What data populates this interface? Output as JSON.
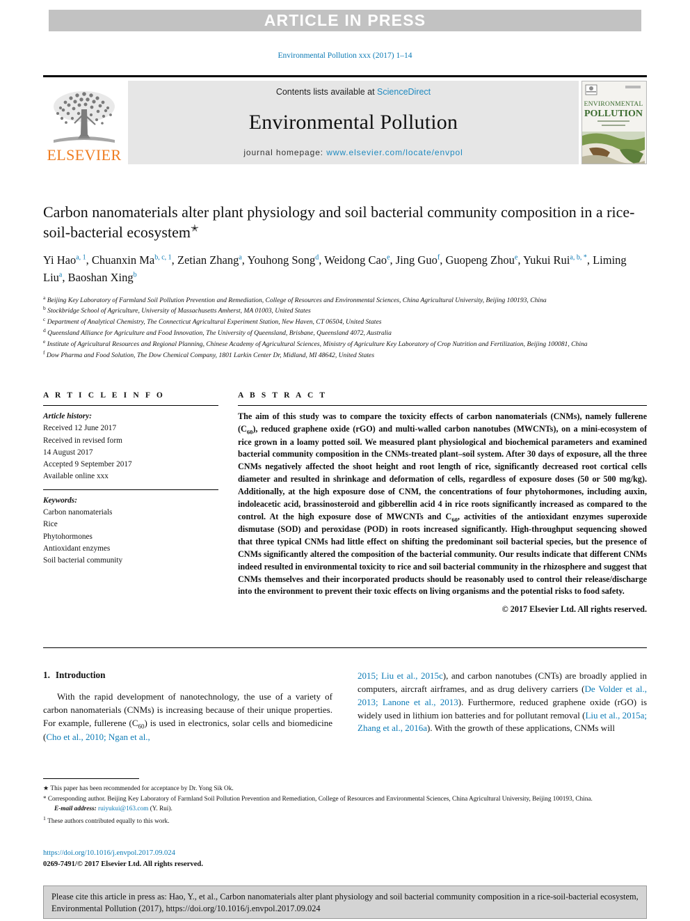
{
  "banner": {
    "label": "ARTICLE IN PRESS"
  },
  "running_head": "Environmental Pollution xxx (2017) 1–14",
  "masthead": {
    "publisher_name": "ELSEVIER",
    "contents_prefix": "Contents lists available at ",
    "contents_link": "ScienceDirect",
    "journal_name": "Environmental Pollution",
    "homepage_prefix": "journal homepage: ",
    "homepage_url": "www.elsevier.com/locate/envpol",
    "cover_title_line1": "ENVIRONMENTAL",
    "cover_title_line2": "POLLUTION"
  },
  "article": {
    "title": "Carbon nanomaterials alter plant physiology and soil bacterial community composition in a rice-soil-bacterial ecosystem",
    "title_marker": "✭",
    "authors": [
      {
        "name": "Yi Hao",
        "sup": "a, 1",
        "sep": ", "
      },
      {
        "name": "Chuanxin Ma",
        "sup": "b, c, 1",
        "sep": ", "
      },
      {
        "name": "Zetian Zhang",
        "sup": "a",
        "sep": ", "
      },
      {
        "name": "Youhong Song",
        "sup": "d",
        "sep": ", "
      },
      {
        "name": "Weidong Cao",
        "sup": "e",
        "sep": ", "
      },
      {
        "name": "Jing Guo",
        "sup": "f",
        "sep": ", "
      },
      {
        "name": "Guopeng Zhou",
        "sup": "e",
        "sep": ", "
      },
      {
        "name": "Yukui Rui",
        "sup": "a, b, *",
        "sep": ", "
      },
      {
        "name": "Liming Liu",
        "sup": "a",
        "sep": ", "
      },
      {
        "name": "Baoshan Xing",
        "sup": "b",
        "sep": ""
      }
    ],
    "affiliations": [
      {
        "mark": "a",
        "text": "Beijing Key Laboratory of Farmland Soil Pollution Prevention and Remediation, College of Resources and Environmental Sciences, China Agricultural University, Beijing 100193, China"
      },
      {
        "mark": "b",
        "text": "Stockbridge School of Agriculture, University of Massachusetts Amherst, MA 01003, United States"
      },
      {
        "mark": "c",
        "text": "Department of Analytical Chemistry, The Connecticut Agricultural Experiment Station, New Haven, CT 06504, United States"
      },
      {
        "mark": "d",
        "text": "Queensland Alliance for Agriculture and Food Innovation, The University of Queensland, Brisbane, Queensland 4072, Australia"
      },
      {
        "mark": "e",
        "text": "Institute of Agricultural Resources and Regional Planning, Chinese Academy of Agricultural Sciences, Ministry of Agriculture Key Laboratory of Crop Nutrition and Fertilization, Beijing 100081, China"
      },
      {
        "mark": "f",
        "text": "Dow Pharma and Food Solution, The Dow Chemical Company, 1801 Larkin Center Dr, Midland, MI 48642, United States"
      }
    ]
  },
  "article_info": {
    "heading": "A R T I C L E   I N F O",
    "history_label": "Article history:",
    "history_lines": [
      "Received 12 June 2017",
      "Received in revised form",
      "14 August 2017",
      "Accepted 9 September 2017",
      "Available online xxx"
    ],
    "keywords_label": "Keywords:",
    "keywords": [
      "Carbon nanomaterials",
      "Rice",
      "Phytohormones",
      "Antioxidant enzymes",
      "Soil bacterial community"
    ]
  },
  "abstract": {
    "heading": "A B S T R A C T",
    "part1": "The aim of this study was to compare the toxicity effects of carbon nanomaterials (CNMs), namely fullerene (C",
    "sub1": "60",
    "part2": "), reduced graphene oxide (rGO) and multi-walled carbon nanotubes (MWCNTs), on a mini-ecosystem of rice grown in a loamy potted soil. We measured plant physiological and biochemical parameters and examined bacterial community composition in the CNMs-treated plant–soil system. After 30 days of exposure, all the three CNMs negatively affected the shoot height and root length of rice, significantly decreased root cortical cells diameter and resulted in shrinkage and deformation of cells, regardless of exposure doses (50 or 500 mg/kg). Additionally, at the high exposure dose of CNM, the concentrations of four phytohormones, including auxin, indoleacetic acid, brassinosteroid and gibberellin acid 4 in rice roots significantly increased as compared to the control. At the high exposure dose of MWCNTs and C",
    "sub2": "60",
    "part3": ", activities of the antioxidant enzymes superoxide dismutase (SOD) and peroxidase (POD) in roots increased significantly. High-throughput sequencing showed that three typical CNMs had little effect on shifting the predominant soil bacterial species, but the presence of CNMs significantly altered the composition of the bacterial community. Our results indicate that different CNMs indeed resulted in environmental toxicity to rice and soil bacterial community in the rhizosphere and suggest that CNMs themselves and their incorporated products should be reasonably used to control their release/discharge into the environment to prevent their toxic effects on living organisms and the potential risks to food safety.",
    "copyright": "© 2017 Elsevier Ltd. All rights reserved."
  },
  "introduction": {
    "number": "1.",
    "heading": "Introduction",
    "left_part1": "With the rapid development of nanotechnology, the use of a variety of carbon nanomaterials (CNMs) is increasing because of their unique properties. For example, fullerene (C",
    "left_sub": "60",
    "left_part2": ") is used in electronics, solar cells and biomedicine (",
    "left_ref1": "Cho et al., 2010; Ngan et al.,",
    "right_ref1": "2015; Liu et al., 2015c",
    "right_part1": "), and carbon nanotubes (CNTs) are broadly applied in computers, aircraft airframes, and as drug delivery carriers (",
    "right_ref2": "De Volder et al., 2013; Lanone et al., 2013",
    "right_part2": "). Furthermore, reduced graphene oxide (rGO) is widely used in lithium ion batteries and for pollutant removal (",
    "right_ref3": "Liu et al., 2015a; Zhang et al., 2016a",
    "right_part3": "). With the growth of these applications, CNMs will"
  },
  "footnotes": {
    "star_note": "This paper has been recommended for acceptance by Dr. Yong Sik Ok.",
    "corresponding_note": "Corresponding author. Beijing Key Laboratory of Farmland Soil Pollution Prevention and Remediation, College of Resources and Environmental Sciences, China Agricultural University, Beijing 100193, China.",
    "email_label": "E-mail address:",
    "email_value": "ruiyukui@163.com",
    "email_owner": "(Y. Rui).",
    "equal_contrib_mark": "1",
    "equal_contrib": "These authors contributed equally to this work."
  },
  "doi_block": {
    "doi_url": "https://doi.org/10.1016/j.envpol.2017.09.024",
    "issn_line": "0269-7491/© 2017 Elsevier Ltd. All rights reserved."
  },
  "citation_box": {
    "text": "Please cite this article in press as: Hao, Y., et al., Carbon nanomaterials alter plant physiology and soil bacterial community composition in a rice-soil-bacterial ecosystem, Environmental Pollution (2017), https://doi.org/10.1016/j.envpol.2017.09.024"
  },
  "colors": {
    "link": "#0b7ab5",
    "elsevier_orange": "#ef7d22",
    "banner_gray": "#c2c2c2",
    "band_gray": "#e6e6e6",
    "cite_box_gray": "#d4d4d4"
  }
}
